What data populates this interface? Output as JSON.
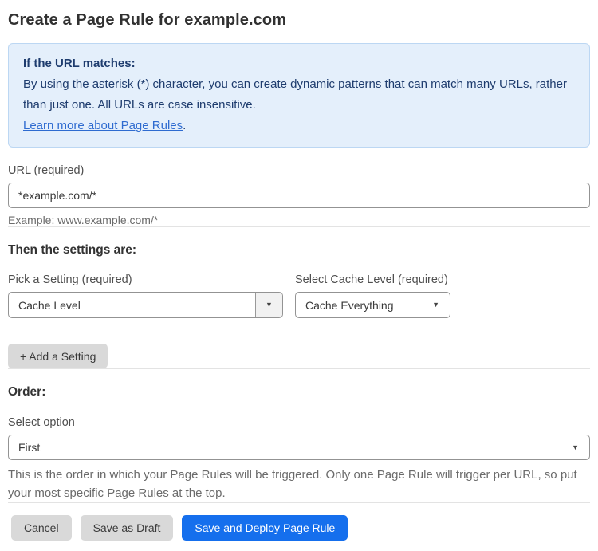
{
  "page": {
    "title": "Create a Page Rule for example.com"
  },
  "info_box": {
    "heading": "If the URL matches:",
    "body": "By using the asterisk (*) character, you can create dynamic patterns that can match many URLs, rather than just one. All URLs are case insensitive.",
    "link_label": "Learn more about Page Rules",
    "link_suffix": "."
  },
  "url_field": {
    "label": "URL (required)",
    "value": "*example.com/*",
    "helper": "Example: www.example.com/*"
  },
  "settings_section": {
    "heading": "Then the settings are:",
    "setting_picker": {
      "label": "Pick a Setting (required)",
      "value": "Cache Level"
    },
    "cache_level_picker": {
      "label": "Select Cache Level (required)",
      "value": "Cache Everything"
    },
    "add_setting_label": "+ Add a Setting"
  },
  "order_section": {
    "heading": "Order:",
    "label": "Select option",
    "value": "First",
    "helper": "This is the order in which your Page Rules will be triggered. Only one Page Rule will trigger per URL, so put your most specific Page Rules at the top."
  },
  "actions": {
    "cancel": "Cancel",
    "save_draft": "Save as Draft",
    "save_deploy": "Save and Deploy Page Rule"
  },
  "icons": {
    "dropdown_arrow": "▼"
  },
  "colors": {
    "info_box_bg": "#e4effb",
    "info_box_border": "#bcd7f3",
    "info_text": "#1e3c6e",
    "link_blue": "#2e6bd0",
    "primary_button_blue": "#156fed",
    "gray_button_bg": "#d9d9d9",
    "input_border": "#939393"
  }
}
